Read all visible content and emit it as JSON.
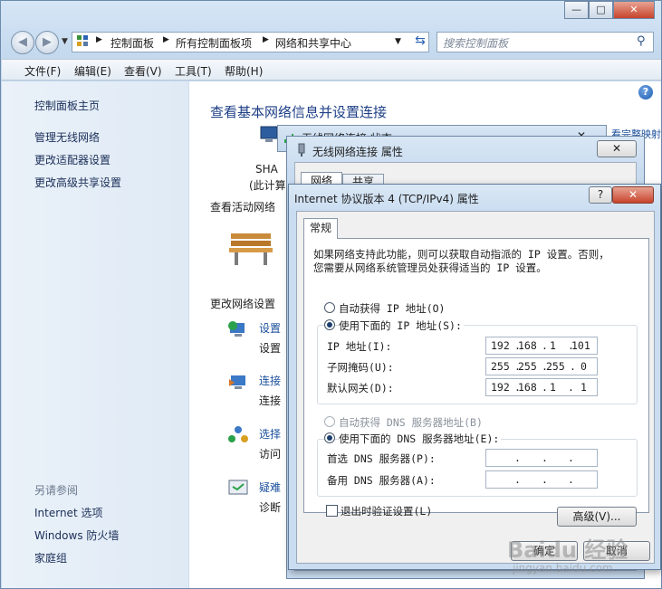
{
  "window": {
    "caption_buttons": {
      "minimize": "—",
      "maximize": "□",
      "close": "✕"
    }
  },
  "address": {
    "breadcrumb": [
      "控制面板",
      "所有控制面板项",
      "网络和共享中心"
    ],
    "search_placeholder": "搜索控制面板"
  },
  "menu": [
    "文件(F)",
    "编辑(E)",
    "查看(V)",
    "工具(T)",
    "帮助(H)"
  ],
  "sidebar": {
    "home": "控制面板主页",
    "links": [
      "管理无线网络",
      "更改适配器设置",
      "更改高级共享设置"
    ],
    "see_also_title": "另请参阅",
    "see_also": [
      "Internet 选项",
      "Windows 防火墙",
      "家庭组"
    ]
  },
  "content": {
    "title": "查看基本网络信息并设置连接",
    "map_link": "看完整映射",
    "computer_name": "SHA",
    "computer_sub": "(此计算",
    "active_label": "查看活动网络",
    "change_label": "更改网络设置",
    "tasks": [
      {
        "title": "设置",
        "desc": "设置"
      },
      {
        "title": "连接",
        "desc": "连接"
      },
      {
        "title": "选择",
        "desc": "访问"
      },
      {
        "title": "疑难",
        "desc": "诊断"
      }
    ]
  },
  "status_dialog": {
    "title": "无线网络连接 状态"
  },
  "wlan_dialog": {
    "title": "无线网络连接 属性",
    "tabs": [
      "网络",
      "共享"
    ]
  },
  "ipv4_dialog": {
    "title": "Internet 协议版本 4 (TCP/IPv4) 属性",
    "tab": "常规",
    "description": "如果网络支持此功能，则可以获取自动指派的 IP 设置。否则，\n您需要从网络系统管理员处获得适当的 IP 设置。",
    "auto_ip": "自动获得 IP 地址(O)",
    "manual_ip": "使用下面的 IP 地址(S):",
    "ip_label": "IP 地址(I):",
    "ip_value": [
      "192",
      "168",
      "1",
      "101"
    ],
    "mask_label": "子网掩码(U):",
    "mask_value": [
      "255",
      "255",
      "255",
      "0"
    ],
    "gateway_label": "默认网关(D):",
    "gateway_value": [
      "192",
      "168",
      "1",
      "1"
    ],
    "auto_dns": "自动获得 DNS 服务器地址(B)",
    "manual_dns": "使用下面的 DNS 服务器地址(E):",
    "dns1_label": "首选 DNS 服务器(P):",
    "dns2_label": "备用 DNS 服务器(A):",
    "validate_label": "退出时验证设置(L)",
    "advanced_button": "高级(V)...",
    "ok_button": "确定",
    "cancel_button": "取消",
    "help_button": "?",
    "close_button": "✕"
  },
  "watermark": {
    "text": "Baidu 经验",
    "url": "jingyan.baidu.com"
  }
}
